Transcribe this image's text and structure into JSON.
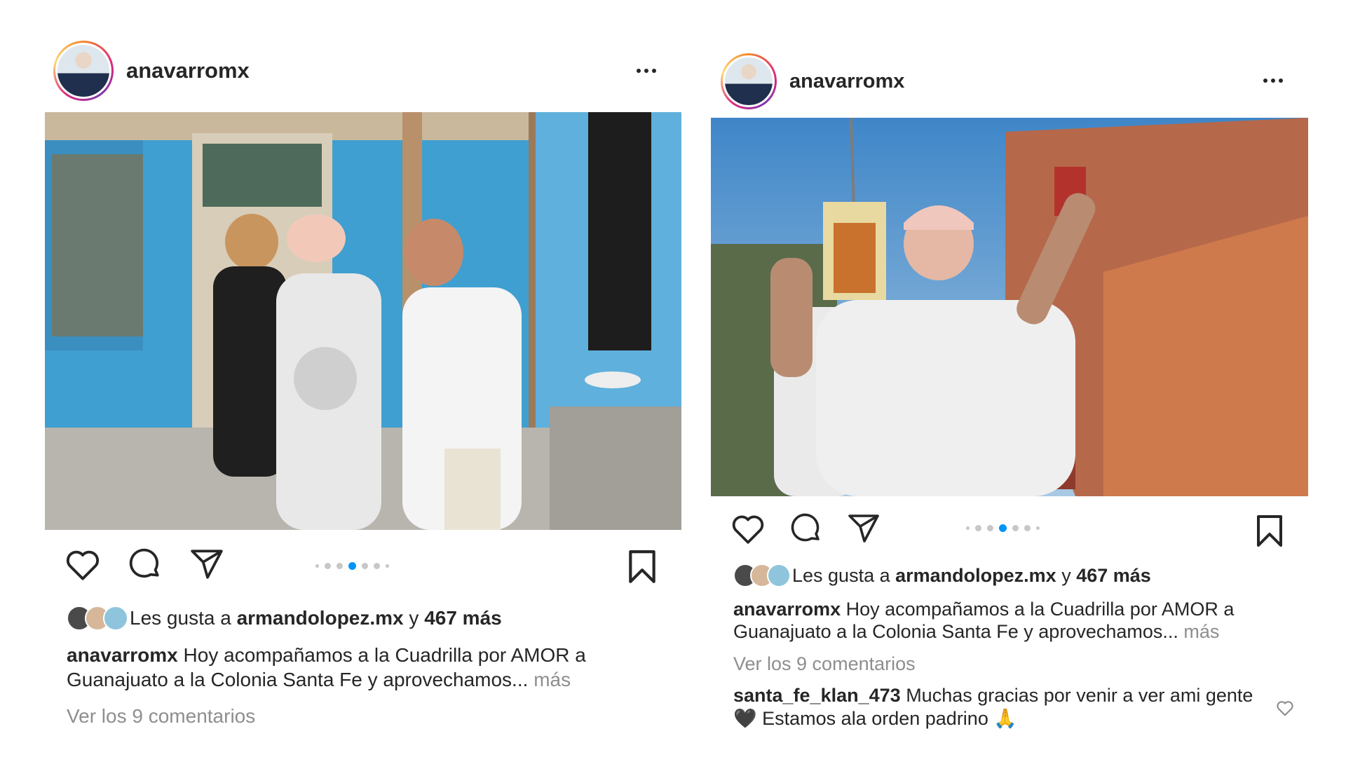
{
  "post_left": {
    "username": "anavarromx",
    "more_icon": "more-horizontal-icon",
    "photo_description_icon": "photo",
    "carousel": {
      "total": 7,
      "active_index": 4
    },
    "likes": {
      "prefix": "Les gusta a",
      "liker": "armandolopez.mx",
      "joiner": "y",
      "count_text": "467 más"
    },
    "caption": {
      "user": "anavarromx",
      "text": "Hoy acompañamos a la Cuadrilla por AMOR a Guanajuato a la Colonia Santa Fe y aprovechamos...",
      "more": "más"
    },
    "view_comments": "Ver los 9 comentarios"
  },
  "post_right": {
    "username": "anavarromx",
    "more_icon": "more-horizontal-icon",
    "carousel": {
      "total": 7,
      "active_index": 4
    },
    "likes": {
      "prefix": "Les gusta a",
      "liker": "armandolopez.mx",
      "joiner": "y",
      "count_text": "467 más"
    },
    "caption": {
      "user": "anavarromx",
      "text": "Hoy acompañamos a la Cuadrilla por AMOR a Guanajuato a la Colonia Santa Fe y aprovechamos...",
      "more": "más"
    },
    "view_comments": "Ver los 9 comentarios",
    "comment": {
      "user": "santa_fe_klan_473",
      "text_1": "Muchas gracias por venir a ver ami gente",
      "heart_emoji": "🖤",
      "text_2": "Estamos ala orden padrino",
      "pray_emoji": "🙏"
    }
  },
  "icons": [
    "heart-icon",
    "comment-icon",
    "share-icon",
    "bookmark-icon"
  ],
  "colors": {
    "active_dot": "#0095f6",
    "muted_text": "#8e8e8e",
    "text": "#262626"
  }
}
